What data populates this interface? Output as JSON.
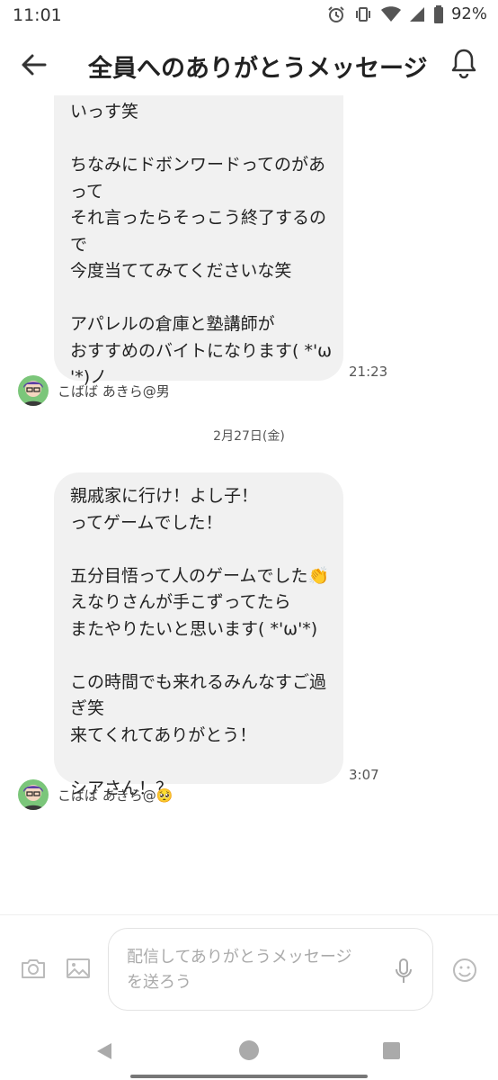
{
  "status_bar": {
    "time": "11:01",
    "battery": "92%"
  },
  "header": {
    "title": "全員へのありがとうメッセージ"
  },
  "messages": [
    {
      "lines": [
        "いっす笑",
        "",
        "ちなみにドボンワードってのがあ",
        "って",
        "それ言ったらそっこう終了するの",
        "で",
        "今度当ててみてくださいな笑",
        "",
        "アパレルの倉庫と塾講師が",
        "おすすめのバイトになります( *'ω",
        "'*)ノ"
      ],
      "time": "21:23",
      "sender": "こばば あきら@男"
    },
    {
      "lines": [
        "親戚家に行け！よし子！",
        "ってゲームでした！",
        "",
        "五分目悟って人のゲームでした👏",
        "えなりさんが手こずってたら",
        "またやりたいと思います( *'ω'*)",
        "",
        "この時間でも来れるみんなすご過",
        "ぎ笑",
        "来てくれてありがとう！",
        "",
        "シアさん！？"
      ],
      "time": "3:07",
      "sender": "こばば あきら@🥺"
    }
  ],
  "date_divider": "2月27日(金)",
  "composer": {
    "placeholder_lines": [
      "配信してありがとうメッセージ",
      "を送ろう"
    ]
  },
  "icons": [
    "back-arrow-icon",
    "bell-icon",
    "camera-icon",
    "image-icon",
    "mic-icon",
    "emoji-icon",
    "alarm-icon",
    "vibrate-icon",
    "wifi-icon",
    "signal-icon",
    "battery-icon"
  ]
}
